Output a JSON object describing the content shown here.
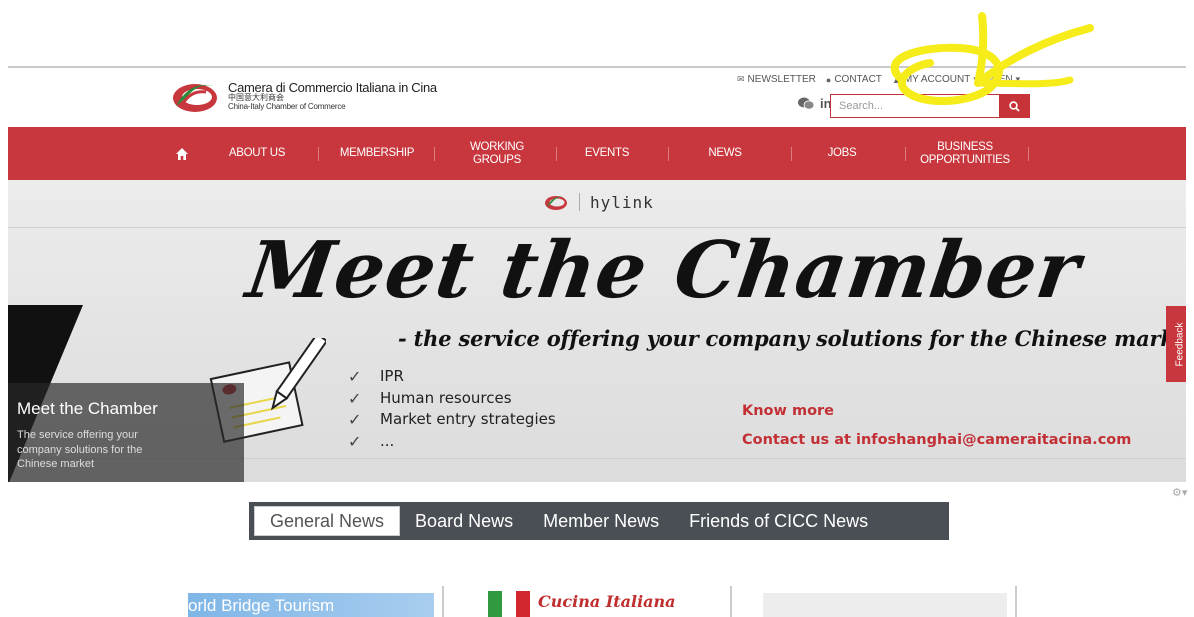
{
  "header": {
    "logo": {
      "name_it": "Camera di Commercio Italiana in Cina",
      "name_cn": "中国意大利商会",
      "name_en": "China-Italy Chamber of Commerce"
    },
    "links": {
      "newsletter": "NEWSLETTER",
      "contact": "CONTACT",
      "my_account": "MY ACCOUNT",
      "language": "EN"
    },
    "social": {
      "linkedin": "in"
    },
    "search": {
      "placeholder": "Search..."
    }
  },
  "nav": {
    "items": [
      {
        "label": "ABOUT US"
      },
      {
        "label": "MEMBERSHIP"
      },
      {
        "label": "WORKING GROUPS"
      },
      {
        "label": "EVENTS"
      },
      {
        "label": "NEWS"
      },
      {
        "label": "JOBS"
      },
      {
        "label": "BUSINESS OPPORTUNITIES"
      }
    ]
  },
  "banner": {
    "partner": "hylink",
    "title": "Meet the Chamber",
    "tagline": "- the service offering your company solutions for the Chinese market -",
    "checks": [
      "IPR",
      "Human resources",
      "Market entry strategies",
      "..."
    ],
    "know_more": "Know more",
    "contact": "Contact us at infoshanghai@cameraitacina.com",
    "caption_title": "Meet the Chamber",
    "caption_desc": "The service offering your company solutions for the Chinese market",
    "feedback": "Feedback"
  },
  "tabs": {
    "items": [
      {
        "label": "General News"
      },
      {
        "label": "Board News"
      },
      {
        "label": "Member News"
      },
      {
        "label": "Friends of CICC News"
      }
    ],
    "active_index": 0
  },
  "news": {
    "thumb1_text": "orld Bridge Tourism",
    "thumb2_text": "Cucina Italiana"
  },
  "colors": {
    "brand_red": "#c8373d",
    "annotation": "#f5ec1a"
  }
}
